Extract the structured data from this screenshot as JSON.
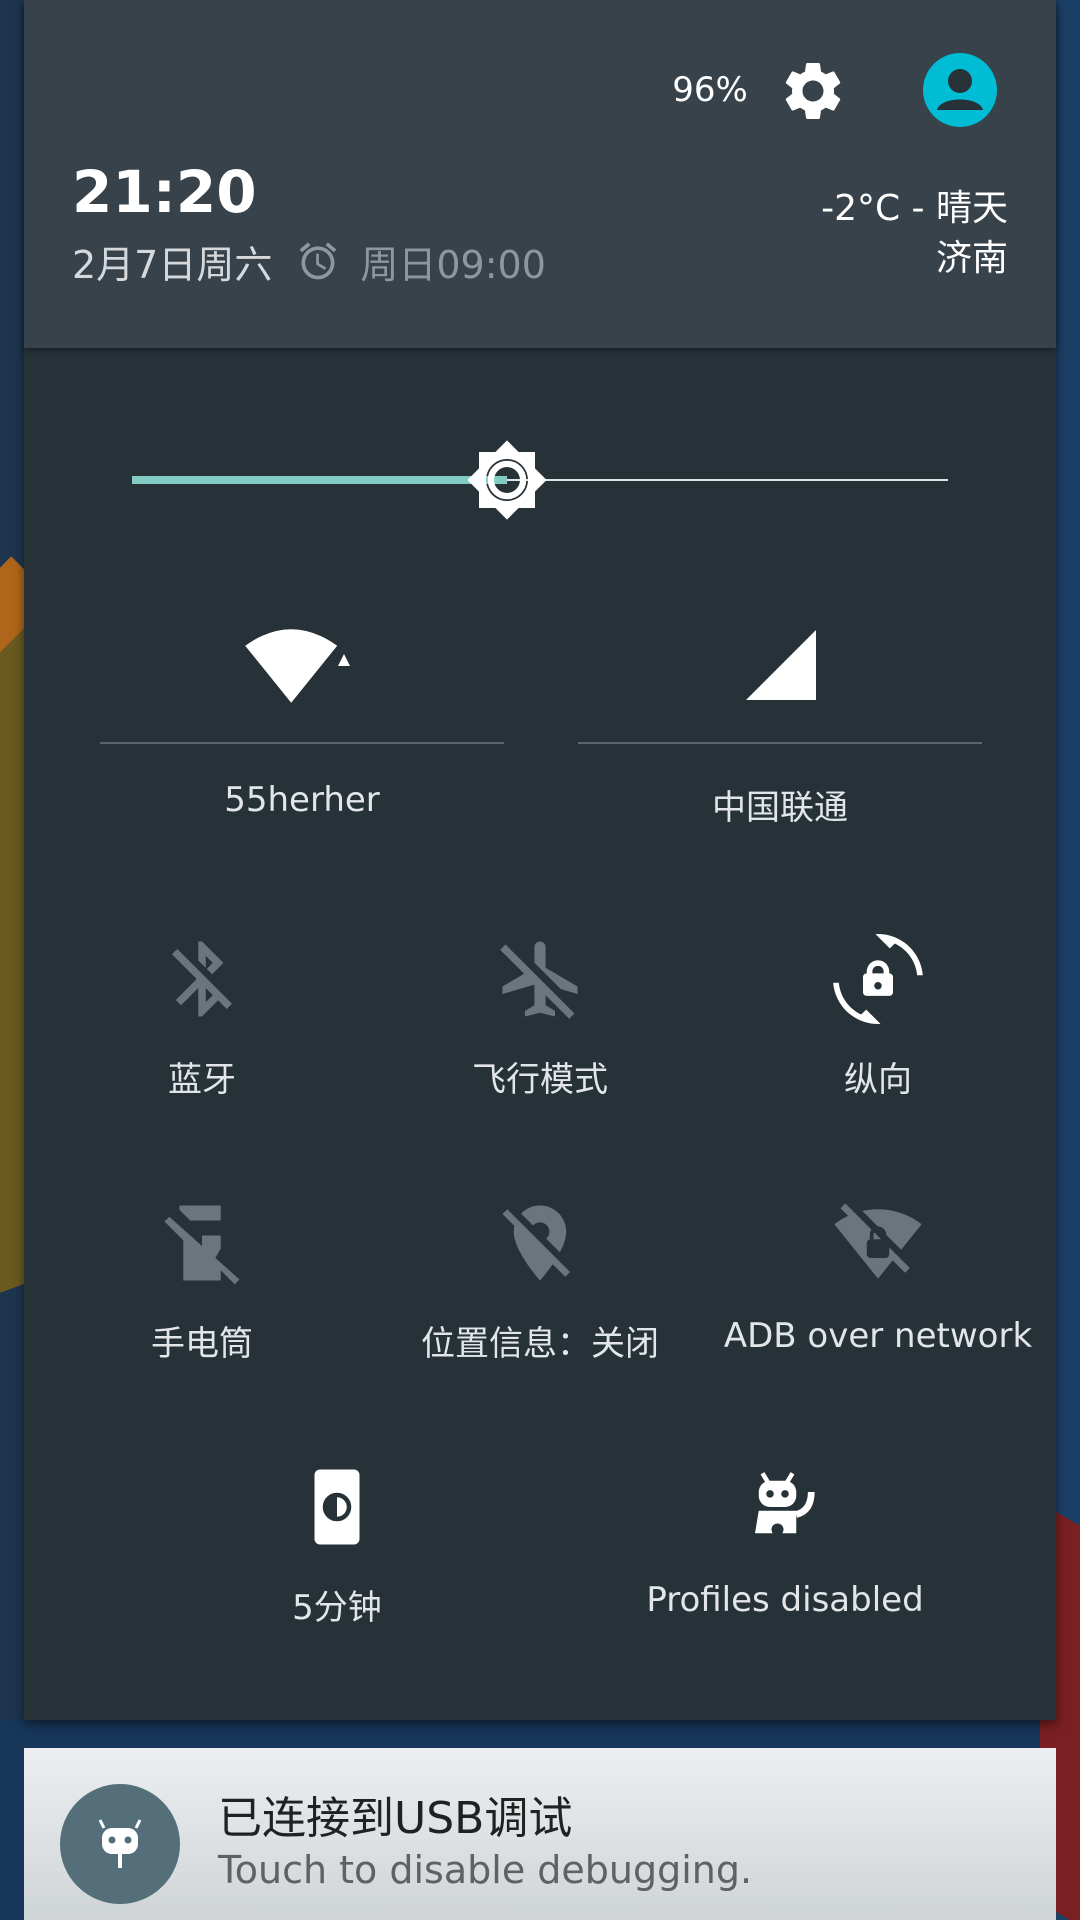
{
  "header": {
    "battery": "96%",
    "time": "21:20",
    "date": "2月7日周六",
    "alarm": "周日09:00",
    "weather_line1": "-2°C - 晴天",
    "weather_line2": "济南",
    "icons": {
      "settings": "gear-icon",
      "user": "avatar-icon",
      "alarm": "alarm-clock-icon"
    }
  },
  "brightness": {
    "level": 0.46,
    "accent": "#80cbc4"
  },
  "big_tiles": [
    {
      "label": "55herher",
      "icon": "wifi-icon"
    },
    {
      "label": "中国联通",
      "icon": "cellular-signal-icon"
    }
  ],
  "tiles": [
    {
      "label": "蓝牙",
      "icon": "bluetooth-off-icon",
      "active": false
    },
    {
      "label": "飞行模式",
      "icon": "airplane-off-icon",
      "active": false
    },
    {
      "label": "纵向",
      "icon": "rotation-lock-icon",
      "active": true
    },
    {
      "label": "手电筒",
      "icon": "flashlight-off-icon",
      "active": false
    },
    {
      "label": "位置信息：关闭",
      "icon": "location-off-icon",
      "active": false
    },
    {
      "label": "ADB over network",
      "icon": "adb-network-off-icon",
      "active": false
    },
    {
      "label": "5分钟",
      "icon": "screen-timeout-icon",
      "active": true
    },
    {
      "label": "Profiles disabled",
      "icon": "profiles-icon",
      "active": true
    }
  ],
  "notification": {
    "title": "已连接到USB调试",
    "text": "Touch to disable debugging.",
    "icon": "cyanogen-bug-icon"
  },
  "colors": {
    "panel_bg": "#263238",
    "header_bg": "#37424a",
    "avatar": "#00bcd4",
    "inactive_icon": "#6b767c"
  }
}
